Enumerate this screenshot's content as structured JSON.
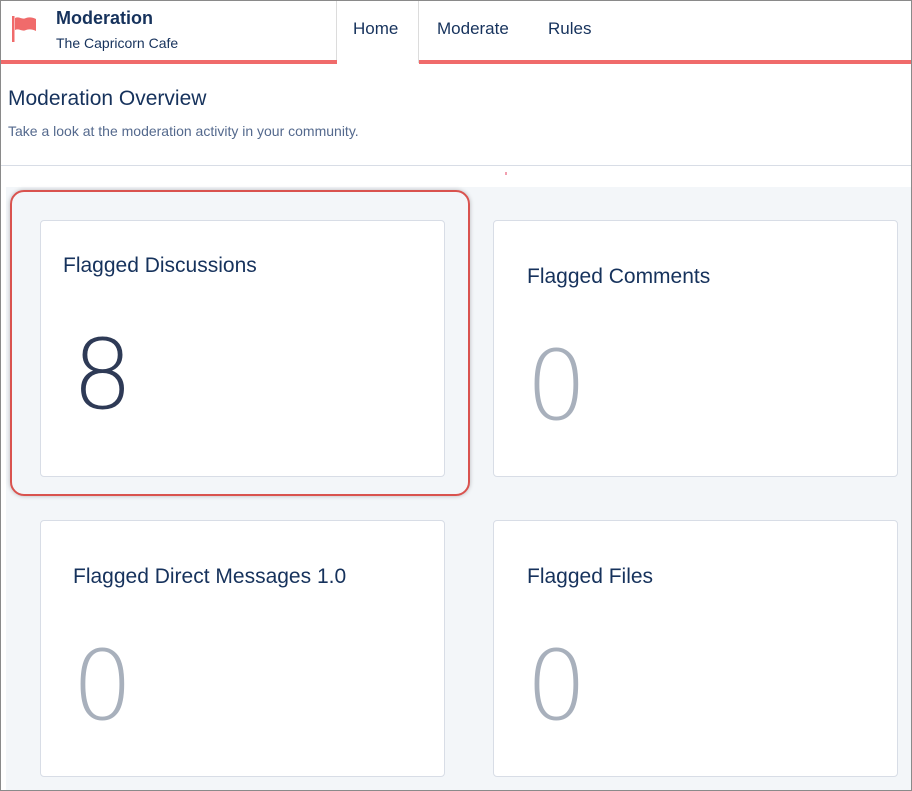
{
  "header": {
    "app_title": "Moderation",
    "app_subtitle": "The Capricorn Cafe",
    "logo_icon": "flag-icon",
    "accent_color": "#f06b6b",
    "tabs": [
      {
        "label": "Home",
        "active": true
      },
      {
        "label": "Moderate",
        "active": false
      },
      {
        "label": "Rules",
        "active": false
      }
    ]
  },
  "page": {
    "title": "Moderation Overview",
    "subtitle": "Take a look at the moderation activity in your community."
  },
  "cards": [
    {
      "title": "Flagged Discussions",
      "value": "8",
      "highlighted": true
    },
    {
      "title": "Flagged Comments",
      "value": "0",
      "highlighted": false
    },
    {
      "title": "Flagged Direct Messages 1.0",
      "value": "0",
      "highlighted": false
    },
    {
      "title": "Flagged Files",
      "value": "0",
      "highlighted": false
    }
  ],
  "colors": {
    "highlight_border": "#d9534f",
    "text_primary": "#16325c",
    "zero_value": "#a8b0bc",
    "active_value": "#2e3a56"
  }
}
